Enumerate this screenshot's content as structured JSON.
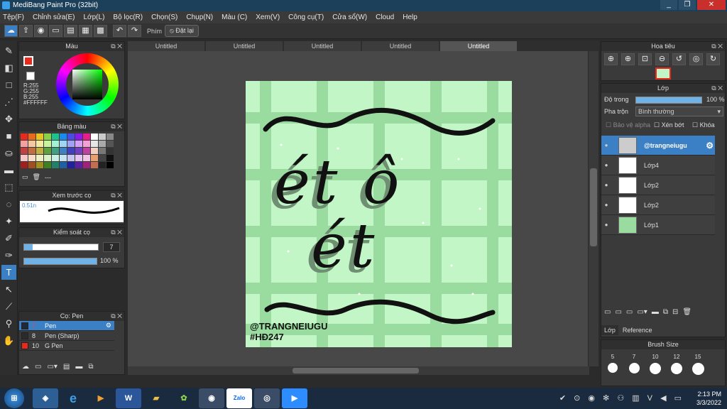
{
  "window": {
    "title": "MediBang Paint Pro (32bit)",
    "minimize": "_",
    "maximize": "❐",
    "close": "✕"
  },
  "menu": [
    "Tệp(F)",
    "Chỉnh sửa(E)",
    "Lớp(L)",
    "Bộ lọc(R)",
    "Chọn(S)",
    "Chụp(N)",
    "Màu (C)",
    "Xem(V)",
    "Công cụ(T)",
    "Cửa sổ(W)",
    "Cloud",
    "Help"
  ],
  "toolbar": {
    "phim_label": "Phím",
    "reset_label": "Đặt lại"
  },
  "color_panel": {
    "title": "Màu",
    "r": "R:255",
    "g": "G:255",
    "b": "B:255",
    "hex": "#FFFFFF"
  },
  "palette_panel": {
    "title": "Bảng màu",
    "more": "---"
  },
  "brush_preview": {
    "title": "Xem trước cọ",
    "size": "0.51n"
  },
  "brush_control": {
    "title": "Kiểm soát cọ",
    "size_value": "7",
    "opacity_value": "100 %",
    "size_fraction": 0.12,
    "opacity_fraction": 1.0
  },
  "brush_panel": {
    "title": "Cọ: Pen",
    "items": [
      {
        "num": "7",
        "name": "Pen",
        "color": "#1e2a3a"
      },
      {
        "num": "8",
        "name": "Pen (Sharp)",
        "color": "#2b2b2b"
      },
      {
        "num": "10",
        "name": "G Pen",
        "color": "#e8291c"
      }
    ]
  },
  "tabs": [
    "Untitled",
    "Untitled",
    "Untitled",
    "Untitled",
    "Untitled"
  ],
  "artwork": {
    "line1": "ét ô",
    "line2": "ét",
    "credit": "@TRANGNEIUGU",
    "hashtag": "#HĐ247"
  },
  "navigator": {
    "title": "Hoa tiêu"
  },
  "layers_panel": {
    "title": "Lớp",
    "opacity_label": "Độ trong",
    "opacity_value": "100 %",
    "blend_label": "Pha trộn",
    "blend_value": "Bình thường",
    "protect_alpha": "Bảo vệ alpha",
    "clipping": "Xén bớt",
    "lock": "Khóa",
    "layers": [
      "@trangneiugu",
      "Lớp4",
      "Lớp2",
      "Lớp2",
      "Lớp1"
    ],
    "tab_layer": "Lớp",
    "tab_reference": "Reference"
  },
  "brush_size": {
    "title": "Brush Size",
    "sizes": [
      "5",
      "7",
      "10",
      "12",
      "15"
    ]
  },
  "taskbar": {
    "time": "2:13 PM",
    "date": "3/3/2022",
    "zalo": "Zalo"
  }
}
